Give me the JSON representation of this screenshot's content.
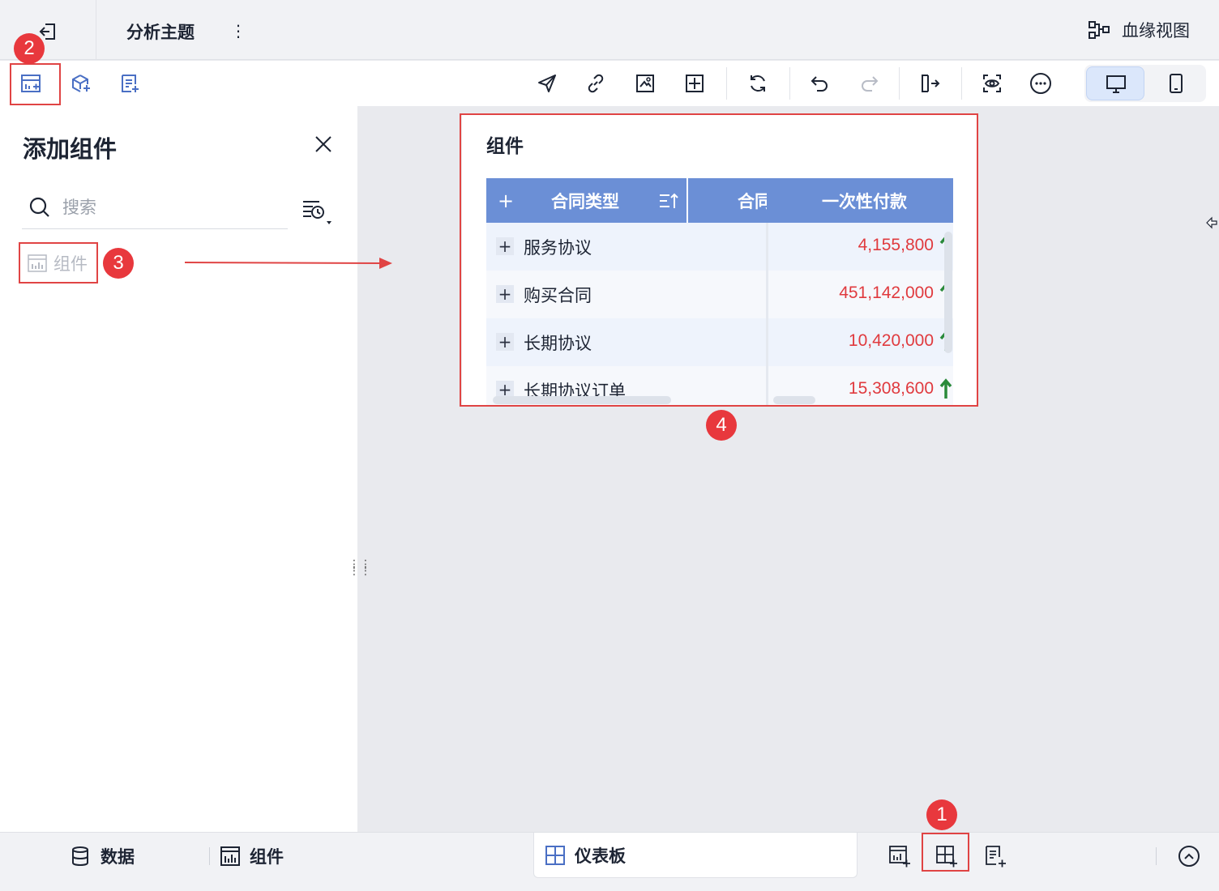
{
  "header": {
    "topic_title": "分析主题",
    "lineage_label": "血缘视图"
  },
  "panel": {
    "title": "添加组件",
    "search_placeholder": "搜索",
    "item_label": "组件"
  },
  "widget": {
    "title": "组件",
    "columns": [
      "合同类型",
      "合同",
      "一次性付款"
    ],
    "rows": [
      {
        "name": "服务协议",
        "value": "4,155,800"
      },
      {
        "name": "购买合同",
        "value": "451,142,000"
      },
      {
        "name": "长期协议",
        "value": "10,420,000"
      },
      {
        "name": "长期协议订单",
        "value": "15,308,600"
      }
    ]
  },
  "badges": {
    "one": "1",
    "two": "2",
    "three": "3",
    "four": "4"
  },
  "bottom": {
    "data_tab": "数据",
    "component_tab": "组件",
    "dashboard_tab": "仪表板"
  },
  "colors": {
    "accent": "#6b8fd6",
    "value_red": "#e03a3e",
    "up_green": "#2a8a3a",
    "highlight": "#e04444"
  }
}
